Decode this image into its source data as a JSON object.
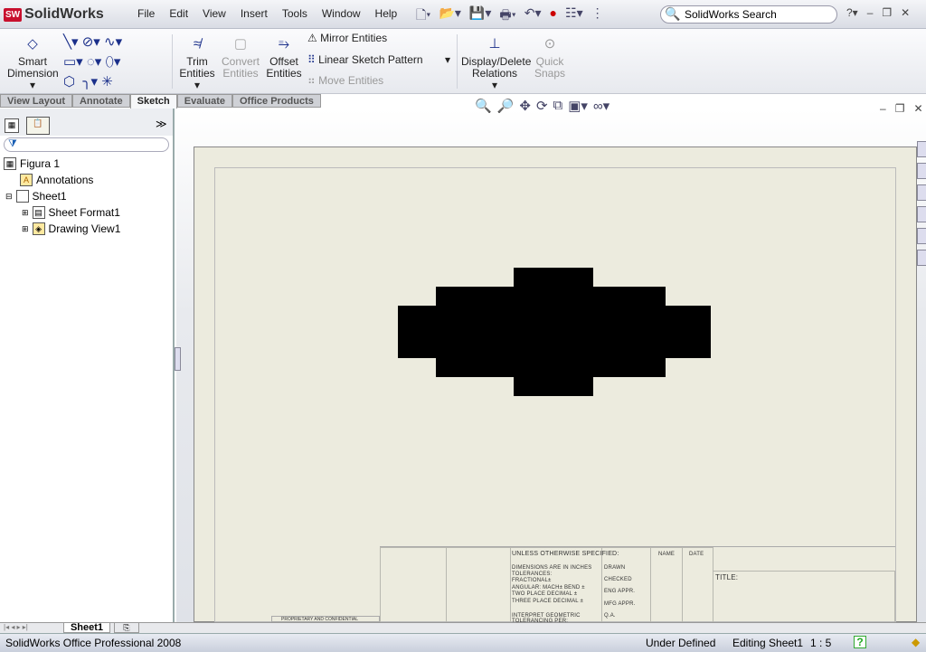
{
  "app": {
    "name": "SolidWorks",
    "logo_badge": "SW"
  },
  "menu": [
    "File",
    "Edit",
    "View",
    "Insert",
    "Tools",
    "Window",
    "Help"
  ],
  "search": {
    "placeholder": "SolidWorks Search"
  },
  "ribbon": {
    "smart_dimension": "Smart Dimension",
    "trim": "Trim Entities",
    "convert": "Convert Entities",
    "offset": "Offset Entities",
    "mirror": "Mirror Entities",
    "linear_pattern": "Linear Sketch Pattern",
    "move": "Move Entities",
    "relations": "Display/Delete Relations",
    "quick_snaps": "Quick Snaps"
  },
  "tabs": [
    {
      "label": "View Layout"
    },
    {
      "label": "Annotate"
    },
    {
      "label": "Sketch",
      "active": true
    },
    {
      "label": "Evaluate"
    },
    {
      "label": "Office Products"
    }
  ],
  "tree": {
    "root": "Figura 1",
    "annotations": "Annotations",
    "sheet": "Sheet1",
    "sheet_format": "Sheet Format1",
    "drawing_view": "Drawing View1"
  },
  "title_block": {
    "unless": "UNLESS OTHERWISE SPECIFIED:",
    "name": "NAME",
    "date": "DATE",
    "dims": "DIMENSIONS ARE IN INCHES",
    "tol": "TOLERANCES:",
    "frac": "FRACTIONAL±",
    "ang": "ANGULAR: MACH±  BEND ±",
    "two": "TWO PLACE DECIMAL  ±",
    "three": "THREE PLACE DECIMAL  ±",
    "interp": "INTERPRET GEOMETRIC",
    "tolling": "TOLERANCING PER:",
    "drawn": "DRAWN",
    "checked": "CHECKED",
    "eng": "ENG APPR.",
    "mfg": "MFG APPR.",
    "qa": "Q.A.",
    "title": "TITLE:",
    "proprietary": "PROPRIETARY AND CONFIDENTIAL"
  },
  "sheet_tab": "Sheet1",
  "status": {
    "product": "SolidWorks Office Professional 2008",
    "state": "Under Defined",
    "editing": "Editing Sheet1",
    "scale": "1 : 5",
    "help": "?"
  },
  "colors": {
    "accent": "#1a2f8a",
    "sheet": "#ecebde",
    "logo": "#c8102e"
  }
}
